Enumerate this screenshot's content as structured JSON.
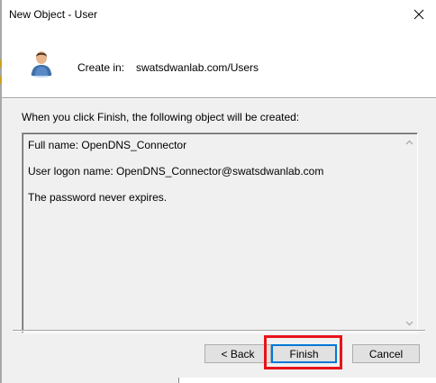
{
  "window": {
    "title": "New Object - User"
  },
  "header": {
    "create_label": "Create in:",
    "create_path": "swatsdwanlab.com/Users",
    "icon": "user-icon"
  },
  "intro": "When you click Finish, the following object will be created:",
  "summary": {
    "lines": [
      "Full name: OpenDNS_Connector",
      "User logon name: OpenDNS_Connector@swatsdwanlab.com",
      "The password never expires."
    ]
  },
  "buttons": {
    "back": "< Back",
    "finish": "Finish",
    "cancel": "Cancel"
  },
  "colors": {
    "highlight": "#e8141a",
    "default_button_border": "#0078d7",
    "dialog_background": "#f0f0f0"
  }
}
